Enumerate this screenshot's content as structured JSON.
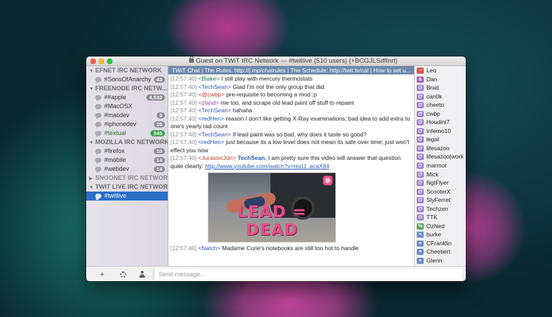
{
  "window": {
    "title": "Guest on TWiT IRC Network — #twitlive (510 users) (+BCGJLSdfInrt)"
  },
  "sidebar": {
    "networks": [
      {
        "name": "EFNET IRC NETWORK",
        "expanded": true,
        "channels": [
          {
            "name": "#SonsOfAnarchy",
            "badge": "43"
          }
        ]
      },
      {
        "name": "FREENODE IRC NETW...",
        "expanded": true,
        "channels": [
          {
            "name": "##apple",
            "badge": "4,532"
          },
          {
            "name": "#MacOSX",
            "badge": ""
          },
          {
            "name": "#macdev",
            "badge": "3"
          },
          {
            "name": "#iphonedev",
            "badge": "28"
          },
          {
            "name": "#textual",
            "badge": "245",
            "badge_color": "#3fa34d"
          }
        ]
      },
      {
        "name": "MOZILLA IRC NETWORK",
        "expanded": true,
        "channels": [
          {
            "name": "#firefox",
            "badge": "10"
          },
          {
            "name": "#mobile",
            "badge": "14"
          },
          {
            "name": "#webdev",
            "badge": "14"
          }
        ]
      },
      {
        "name": "SNOONET IRC NETWORK",
        "expanded": false,
        "channels": []
      },
      {
        "name": "TWIT LIVE IRC NETWORK",
        "expanded": true,
        "channels": [
          {
            "name": "#twitlive",
            "badge": "",
            "selected": true
          }
        ]
      }
    ]
  },
  "chat": {
    "topic": "TWiT Chat | The Rules: http://j.mp/chatrules | The Schedule: http://twit.tv/cal | How to set u...",
    "messages": [
      {
        "time": "[12:57:40]",
        "nick": "<Blake>",
        "nick_color": "#1f7a4f",
        "text": " I still play with mercury thermostats"
      },
      {
        "time": "[12:57:40]",
        "nick": "<TechSean>",
        "nick_color": "#2b56b3",
        "text": " Glad I'm not the only group that did."
      },
      {
        "time": "[12:57:40]",
        "nick": "<@cwbp>",
        "nick_color": "#c0392b",
        "text": " pre-requisite to becoming a mod :p"
      },
      {
        "time": "[12:57:40]",
        "nick": "<zland>",
        "nick_color": "#8e44ad",
        "text": " me too, and scrape old lead paint off stuff to repaint"
      },
      {
        "time": "[12:57:40]",
        "nick": "<TechSean>",
        "nick_color": "#2b56b3",
        "text": " hahaha"
      },
      {
        "time": "[12:57:40]",
        "nick": "<redHen>",
        "nick_color": "#2b56b3",
        "text": " reason I don't like getting X-Ray examinations; bad idea to add extra to one's yearly rad count"
      },
      {
        "time": "[12:57:40]",
        "nick": "<TechSean>",
        "nick_color": "#2b56b3",
        "text": " if lead paint was so bad, why does it taste so good?"
      },
      {
        "time": "[12:57:40]",
        "nick": "<redHen>",
        "nick_color": "#2b56b3",
        "text": " just because its a low level does not mean its safe over time; just won't effect you now"
      },
      {
        "time": "[12:57:40]",
        "nick": "<JurassicJon>",
        "nick_color": "#c0392b",
        "mention": "TechSean",
        "text": ", I am pretty sure this video will answer that question quite clearly: ",
        "link": "http://www.youtube.com/watch?v=mxIJ_acaX84"
      }
    ],
    "image_preview": {
      "caption": "LEAD = DEAD"
    },
    "last_message": {
      "time": "[12:57:40]",
      "nick": "<Natch>",
      "nick_color": "#2b56b3",
      "text": " Madame Curie's notebooks are still too hot to handle"
    }
  },
  "users": [
    {
      "mode": "~",
      "name": "Leo",
      "color": "#d9534f"
    },
    {
      "mode": "&",
      "name": "Dan",
      "color": "#a35bb5"
    },
    {
      "mode": "@",
      "name": "Brad",
      "color": "#9a78c8"
    },
    {
      "mode": "@",
      "name": "can0k",
      "color": "#9a78c8"
    },
    {
      "mode": "@",
      "name": "cheeto",
      "color": "#9a78c8"
    },
    {
      "mode": "@",
      "name": "cwbp",
      "color": "#9a78c8"
    },
    {
      "mode": "@",
      "name": "Houdini7",
      "color": "#9a78c8"
    },
    {
      "mode": "@",
      "name": "inferno10",
      "color": "#9a78c8"
    },
    {
      "mode": "@",
      "name": "legat",
      "color": "#9a78c8"
    },
    {
      "mode": "@",
      "name": "lifesazoo",
      "color": "#9a78c8"
    },
    {
      "mode": "@",
      "name": "lifesazoo|work",
      "color": "#9a78c8"
    },
    {
      "mode": "@",
      "name": "marmot",
      "color": "#9a78c8"
    },
    {
      "mode": "@",
      "name": "Mick",
      "color": "#9a78c8"
    },
    {
      "mode": "@",
      "name": "NgtFlyer",
      "color": "#9a78c8"
    },
    {
      "mode": "@",
      "name": "ScooterX",
      "color": "#9a78c8"
    },
    {
      "mode": "@",
      "name": "SlyFerret",
      "color": "#9a78c8"
    },
    {
      "mode": "@",
      "name": "Techzen",
      "color": "#9a78c8"
    },
    {
      "mode": "@",
      "name": "TTK",
      "color": "#9a78c8"
    },
    {
      "mode": "%",
      "name": "OzNed",
      "color": "#5aa05a"
    },
    {
      "mode": "+",
      "name": "burke",
      "color": "#6f8fc7"
    },
    {
      "mode": "+",
      "name": "CFranklin",
      "color": "#6f8fc7"
    },
    {
      "mode": "+",
      "name": "Cheebert",
      "color": "#6f8fc7"
    },
    {
      "mode": "+",
      "name": "Glenn",
      "color": "#6f8fc7"
    }
  ],
  "bottom": {
    "add_label": "+",
    "input_placeholder": "Send message..."
  }
}
